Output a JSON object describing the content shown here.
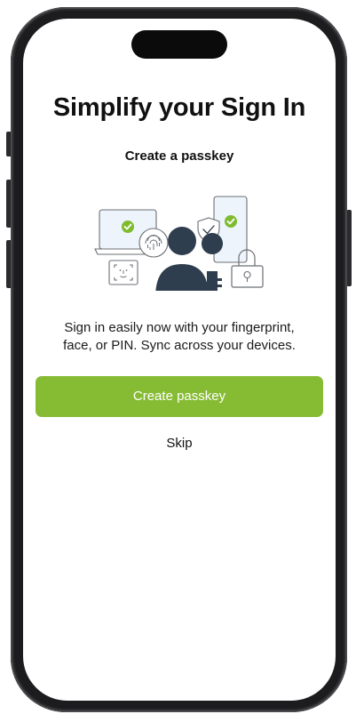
{
  "screen": {
    "title": "Simplify your Sign In",
    "subtitle": "Create a passkey",
    "description_line1": "Sign in easily now with your fingerprint,",
    "description_line2": "face, or PIN. Sync across your devices.",
    "primary_button_label": "Create passkey",
    "skip_label": "Skip"
  },
  "illustration": {
    "icons": [
      "laptop-icon",
      "checkmark-icon",
      "fingerprint-icon",
      "face-id-icon",
      "user-icon",
      "key-icon",
      "shield-check-icon",
      "phone-icon",
      "padlock-icon"
    ]
  },
  "colors": {
    "accent": "#86bb34",
    "check_green": "#7fbb2f",
    "figure_dark": "#2f3e4e",
    "device_fill": "#eef4fb"
  }
}
